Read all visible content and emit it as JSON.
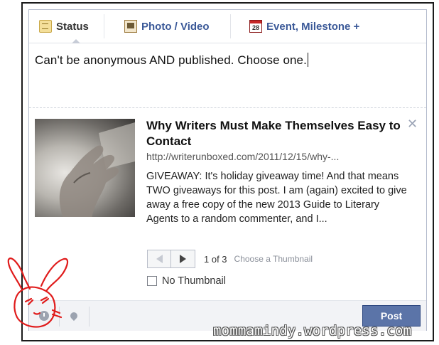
{
  "tabs": {
    "status": "Status",
    "photo": "Photo / Video",
    "event": "Event, Milestone +",
    "event_icon_day": "28"
  },
  "composer": {
    "text": "Can't be anonymous AND published.  Choose one."
  },
  "link_preview": {
    "title": "Why Writers Must Make Themselves Easy to Contact",
    "url": "http://writerunboxed.com/2011/12/15/why-...",
    "description": "GIVEAWAY: It's holiday giveaway time! And that means TWO giveaways for this post. I am (again) excited to give away a free copy of the new 2013 Guide to Literary Agents to a random commenter, and I...",
    "thumbnail_counter": "1 of 3",
    "thumbnail_hint": "Choose a Thumbnail",
    "no_thumbnail_label": "No Thumbnail",
    "close_glyph": "✕"
  },
  "footer": {
    "post_label": "Post",
    "icons": [
      "clock-icon",
      "location-pin-icon"
    ]
  },
  "watermark": "mommamindy.wordpress.com",
  "colors": {
    "accent": "#3b5998",
    "post_button": "#5b74a8",
    "doodle": "#e01b1b"
  }
}
